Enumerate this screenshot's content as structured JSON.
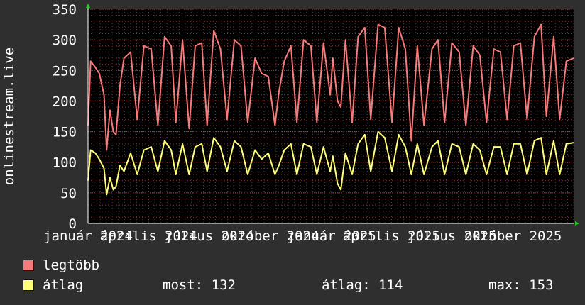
{
  "chart_data": {
    "type": "line",
    "ylabel": "onlinestream.live",
    "ylim": [
      0,
      350
    ],
    "yticks": [
      "0",
      "50",
      "100",
      "150",
      "200",
      "250",
      "300",
      "350"
    ],
    "xlim": [
      "2024-01-01",
      "2025-12-31"
    ],
    "xticks": [
      {
        "date": "2024-01-01",
        "label": "január 2024"
      },
      {
        "date": "2024-04-01",
        "label": "április 2024"
      },
      {
        "date": "2024-07-01",
        "label": "július 2024"
      },
      {
        "date": "2024-10-01",
        "label": "október 2024"
      },
      {
        "date": "2025-01-01",
        "label": "január 2025"
      },
      {
        "date": "2025-04-01",
        "label": "április 2025"
      },
      {
        "date": "2025-07-01",
        "label": "július 2025"
      },
      {
        "date": "2025-10-01",
        "label": "október 2025"
      }
    ],
    "grid": true,
    "series": [
      {
        "name": "legtöbb",
        "color": "#f77b7b",
        "points": [
          [
            "2024-01-01",
            160
          ],
          [
            "2024-01-05",
            265
          ],
          [
            "2024-01-12",
            255
          ],
          [
            "2024-01-18",
            245
          ],
          [
            "2024-01-25",
            210
          ],
          [
            "2024-01-29",
            120
          ],
          [
            "2024-02-03",
            185
          ],
          [
            "2024-02-08",
            150
          ],
          [
            "2024-02-12",
            145
          ],
          [
            "2024-02-18",
            225
          ],
          [
            "2024-02-24",
            270
          ],
          [
            "2024-03-05",
            280
          ],
          [
            "2024-03-15",
            170
          ],
          [
            "2024-03-25",
            290
          ],
          [
            "2024-04-05",
            285
          ],
          [
            "2024-04-15",
            160
          ],
          [
            "2024-04-25",
            305
          ],
          [
            "2024-05-05",
            290
          ],
          [
            "2024-05-12",
            165
          ],
          [
            "2024-05-22",
            300
          ],
          [
            "2024-06-01",
            155
          ],
          [
            "2024-06-10",
            290
          ],
          [
            "2024-06-20",
            295
          ],
          [
            "2024-06-28",
            160
          ],
          [
            "2024-07-08",
            315
          ],
          [
            "2024-07-18",
            285
          ],
          [
            "2024-07-28",
            170
          ],
          [
            "2024-08-08",
            300
          ],
          [
            "2024-08-18",
            290
          ],
          [
            "2024-08-28",
            165
          ],
          [
            "2024-09-08",
            270
          ],
          [
            "2024-09-18",
            245
          ],
          [
            "2024-09-28",
            240
          ],
          [
            "2024-10-08",
            160
          ],
          [
            "2024-10-14",
            215
          ],
          [
            "2024-10-22",
            265
          ],
          [
            "2024-11-01",
            290
          ],
          [
            "2024-11-10",
            165
          ],
          [
            "2024-11-20",
            300
          ],
          [
            "2024-12-01",
            290
          ],
          [
            "2024-12-10",
            165
          ],
          [
            "2024-12-20",
            295
          ],
          [
            "2024-12-30",
            210
          ],
          [
            "2025-01-03",
            270
          ],
          [
            "2025-01-10",
            200
          ],
          [
            "2025-01-15",
            190
          ],
          [
            "2025-01-22",
            300
          ],
          [
            "2025-02-01",
            165
          ],
          [
            "2025-02-10",
            305
          ],
          [
            "2025-02-20",
            320
          ],
          [
            "2025-03-01",
            170
          ],
          [
            "2025-03-12",
            325
          ],
          [
            "2025-03-22",
            320
          ],
          [
            "2025-04-02",
            165
          ],
          [
            "2025-04-12",
            320
          ],
          [
            "2025-04-22",
            285
          ],
          [
            "2025-05-01",
            135
          ],
          [
            "2025-05-10",
            290
          ],
          [
            "2025-05-20",
            160
          ],
          [
            "2025-06-01",
            285
          ],
          [
            "2025-06-10",
            300
          ],
          [
            "2025-06-20",
            165
          ],
          [
            "2025-07-01",
            295
          ],
          [
            "2025-07-12",
            280
          ],
          [
            "2025-07-22",
            160
          ],
          [
            "2025-08-02",
            290
          ],
          [
            "2025-08-12",
            275
          ],
          [
            "2025-08-22",
            165
          ],
          [
            "2025-09-02",
            285
          ],
          [
            "2025-09-12",
            280
          ],
          [
            "2025-09-22",
            170
          ],
          [
            "2025-10-02",
            290
          ],
          [
            "2025-10-12",
            295
          ],
          [
            "2025-10-22",
            170
          ],
          [
            "2025-11-02",
            305
          ],
          [
            "2025-11-12",
            325
          ],
          [
            "2025-11-20",
            175
          ],
          [
            "2025-12-01",
            305
          ],
          [
            "2025-12-10",
            170
          ],
          [
            "2025-12-20",
            265
          ],
          [
            "2025-12-31",
            270
          ]
        ]
      },
      {
        "name": "átlag",
        "color": "#ffff7a",
        "points": [
          [
            "2024-01-01",
            70
          ],
          [
            "2024-01-05",
            120
          ],
          [
            "2024-01-12",
            115
          ],
          [
            "2024-01-18",
            105
          ],
          [
            "2024-01-25",
            90
          ],
          [
            "2024-01-29",
            47
          ],
          [
            "2024-02-03",
            75
          ],
          [
            "2024-02-08",
            55
          ],
          [
            "2024-02-12",
            60
          ],
          [
            "2024-02-18",
            95
          ],
          [
            "2024-02-24",
            85
          ],
          [
            "2024-03-05",
            115
          ],
          [
            "2024-03-15",
            80
          ],
          [
            "2024-03-25",
            120
          ],
          [
            "2024-04-05",
            125
          ],
          [
            "2024-04-15",
            85
          ],
          [
            "2024-04-25",
            135
          ],
          [
            "2024-05-05",
            120
          ],
          [
            "2024-05-12",
            80
          ],
          [
            "2024-05-22",
            130
          ],
          [
            "2024-06-01",
            80
          ],
          [
            "2024-06-10",
            125
          ],
          [
            "2024-06-20",
            130
          ],
          [
            "2024-06-28",
            85
          ],
          [
            "2024-07-08",
            140
          ],
          [
            "2024-07-18",
            125
          ],
          [
            "2024-07-28",
            85
          ],
          [
            "2024-08-08",
            135
          ],
          [
            "2024-08-18",
            125
          ],
          [
            "2024-08-28",
            80
          ],
          [
            "2024-09-08",
            120
          ],
          [
            "2024-09-18",
            105
          ],
          [
            "2024-09-28",
            115
          ],
          [
            "2024-10-08",
            80
          ],
          [
            "2024-10-14",
            95
          ],
          [
            "2024-10-22",
            120
          ],
          [
            "2024-11-01",
            130
          ],
          [
            "2024-11-10",
            80
          ],
          [
            "2024-11-20",
            130
          ],
          [
            "2024-12-01",
            125
          ],
          [
            "2024-12-10",
            80
          ],
          [
            "2024-12-20",
            125
          ],
          [
            "2024-12-30",
            85
          ],
          [
            "2025-01-03",
            110
          ],
          [
            "2025-01-10",
            65
          ],
          [
            "2025-01-15",
            55
          ],
          [
            "2025-01-22",
            115
          ],
          [
            "2025-02-01",
            80
          ],
          [
            "2025-02-10",
            130
          ],
          [
            "2025-02-20",
            145
          ],
          [
            "2025-03-01",
            85
          ],
          [
            "2025-03-12",
            150
          ],
          [
            "2025-03-22",
            140
          ],
          [
            "2025-04-02",
            85
          ],
          [
            "2025-04-12",
            145
          ],
          [
            "2025-04-22",
            125
          ],
          [
            "2025-05-01",
            80
          ],
          [
            "2025-05-10",
            130
          ],
          [
            "2025-05-20",
            80
          ],
          [
            "2025-06-01",
            125
          ],
          [
            "2025-06-10",
            135
          ],
          [
            "2025-06-20",
            80
          ],
          [
            "2025-07-01",
            130
          ],
          [
            "2025-07-12",
            125
          ],
          [
            "2025-07-22",
            80
          ],
          [
            "2025-08-02",
            130
          ],
          [
            "2025-08-12",
            120
          ],
          [
            "2025-08-22",
            80
          ],
          [
            "2025-09-02",
            125
          ],
          [
            "2025-09-12",
            125
          ],
          [
            "2025-09-22",
            80
          ],
          [
            "2025-10-02",
            130
          ],
          [
            "2025-10-12",
            130
          ],
          [
            "2025-10-22",
            80
          ],
          [
            "2025-11-02",
            135
          ],
          [
            "2025-11-12",
            140
          ],
          [
            "2025-11-20",
            80
          ],
          [
            "2025-12-01",
            135
          ],
          [
            "2025-12-10",
            80
          ],
          [
            "2025-12-20",
            130
          ],
          [
            "2025-12-31",
            132
          ]
        ]
      }
    ]
  },
  "legend": {
    "max_label": "legtöbb",
    "avg_label": "átlag",
    "stat_now": "most: 132",
    "stat_avg": "átlag: 114",
    "stat_max": "max: 153"
  }
}
